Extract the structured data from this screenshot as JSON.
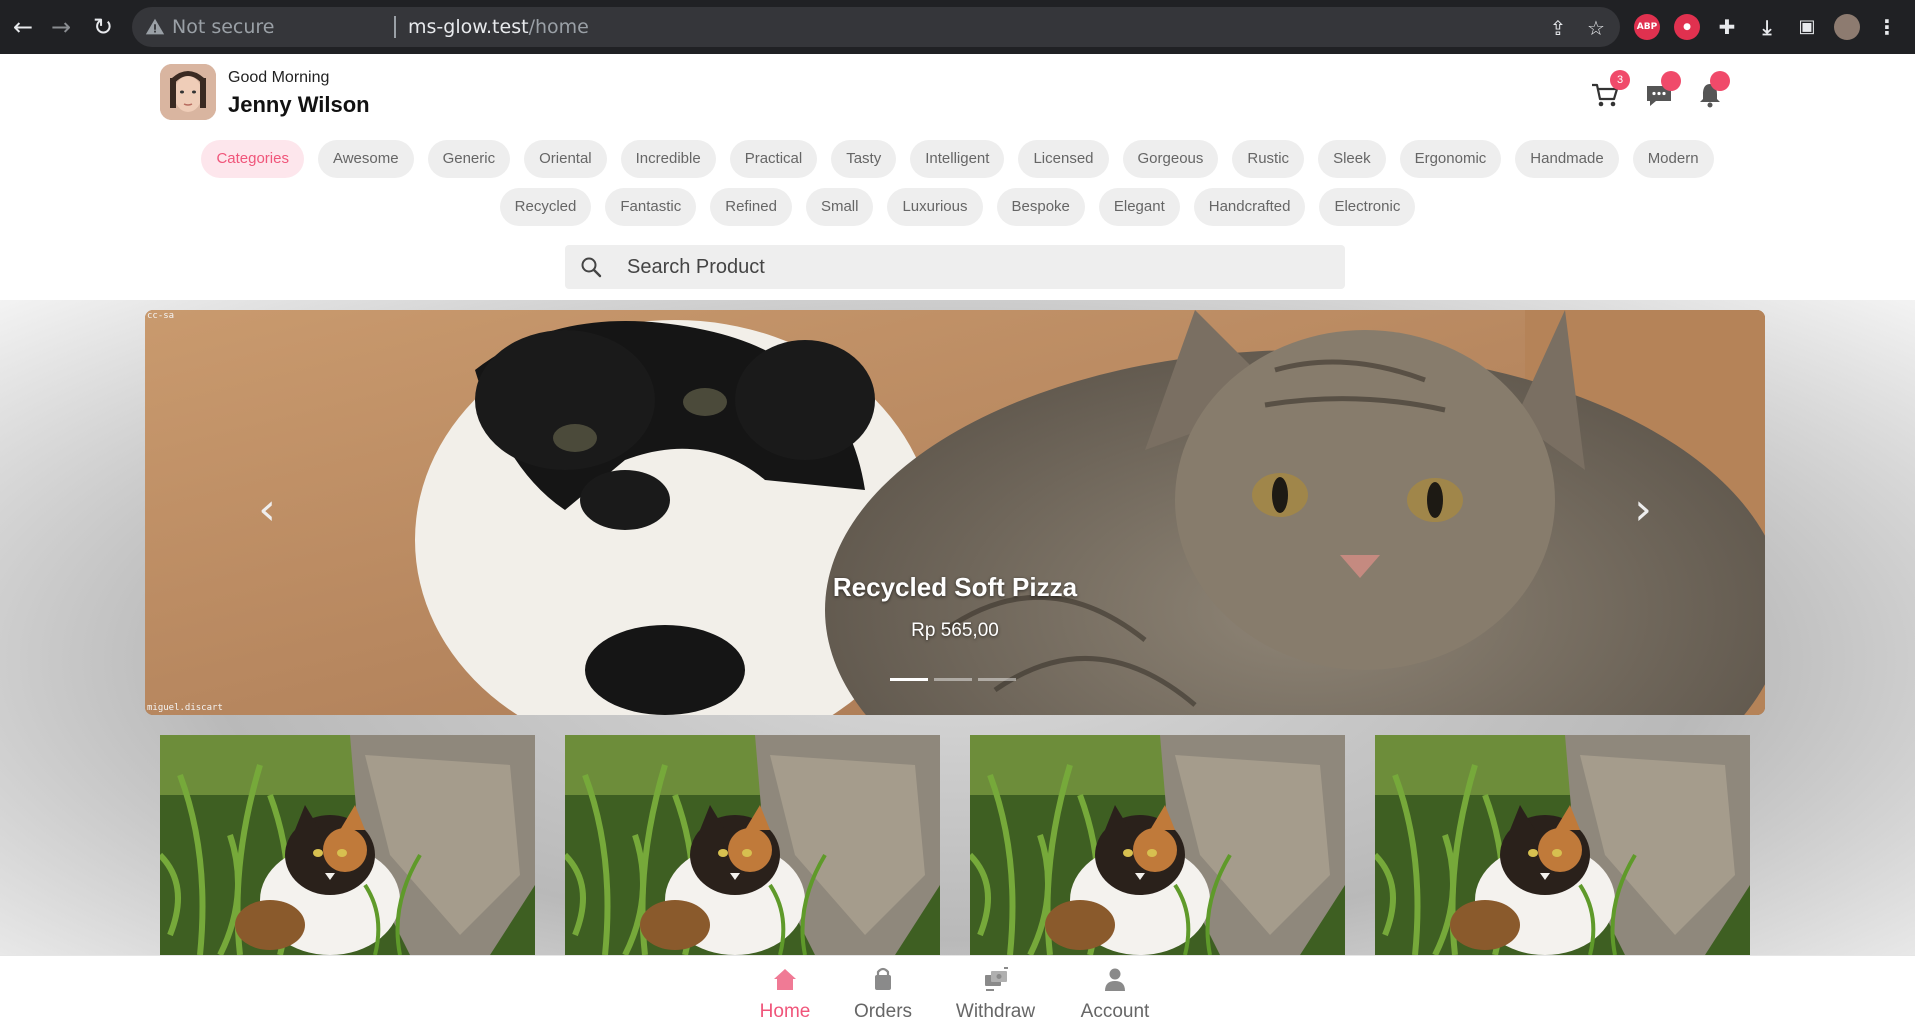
{
  "browser": {
    "security_label": "Not secure",
    "url_host": "ms-glow.test",
    "url_path": "/home",
    "ext_abp": "ABP"
  },
  "header": {
    "greeting": "Good Morning",
    "user_name": "Jenny Wilson",
    "cart_count": "3"
  },
  "categories": {
    "row1": [
      "Categories",
      "Awesome",
      "Generic",
      "Oriental",
      "Incredible",
      "Practical",
      "Tasty",
      "Intelligent",
      "Licensed",
      "Gorgeous",
      "Rustic",
      "Sleek",
      "Ergonomic",
      "Handmade",
      "Modern"
    ],
    "row2": [
      "Recycled",
      "Fantastic",
      "Refined",
      "Small",
      "Luxurious",
      "Bespoke",
      "Elegant",
      "Handcrafted",
      "Electronic"
    ],
    "active": "Categories"
  },
  "search": {
    "placeholder": "Search Product"
  },
  "carousel": {
    "title": "Recycled Soft Pizza",
    "price": "Rp 565,00",
    "slide_count": 3,
    "active_slide": 1,
    "watermark_top": "cc-sa",
    "watermark_bottom": "miguel.discart"
  },
  "products": {
    "count_visible": 4
  },
  "bottom_nav": {
    "items": [
      "Home",
      "Orders",
      "Withdraw",
      "Account"
    ],
    "active": "Home"
  },
  "colors": {
    "accent": "#f0557a",
    "chip_bg": "#eeeeee",
    "badge": "#f04a6a"
  }
}
